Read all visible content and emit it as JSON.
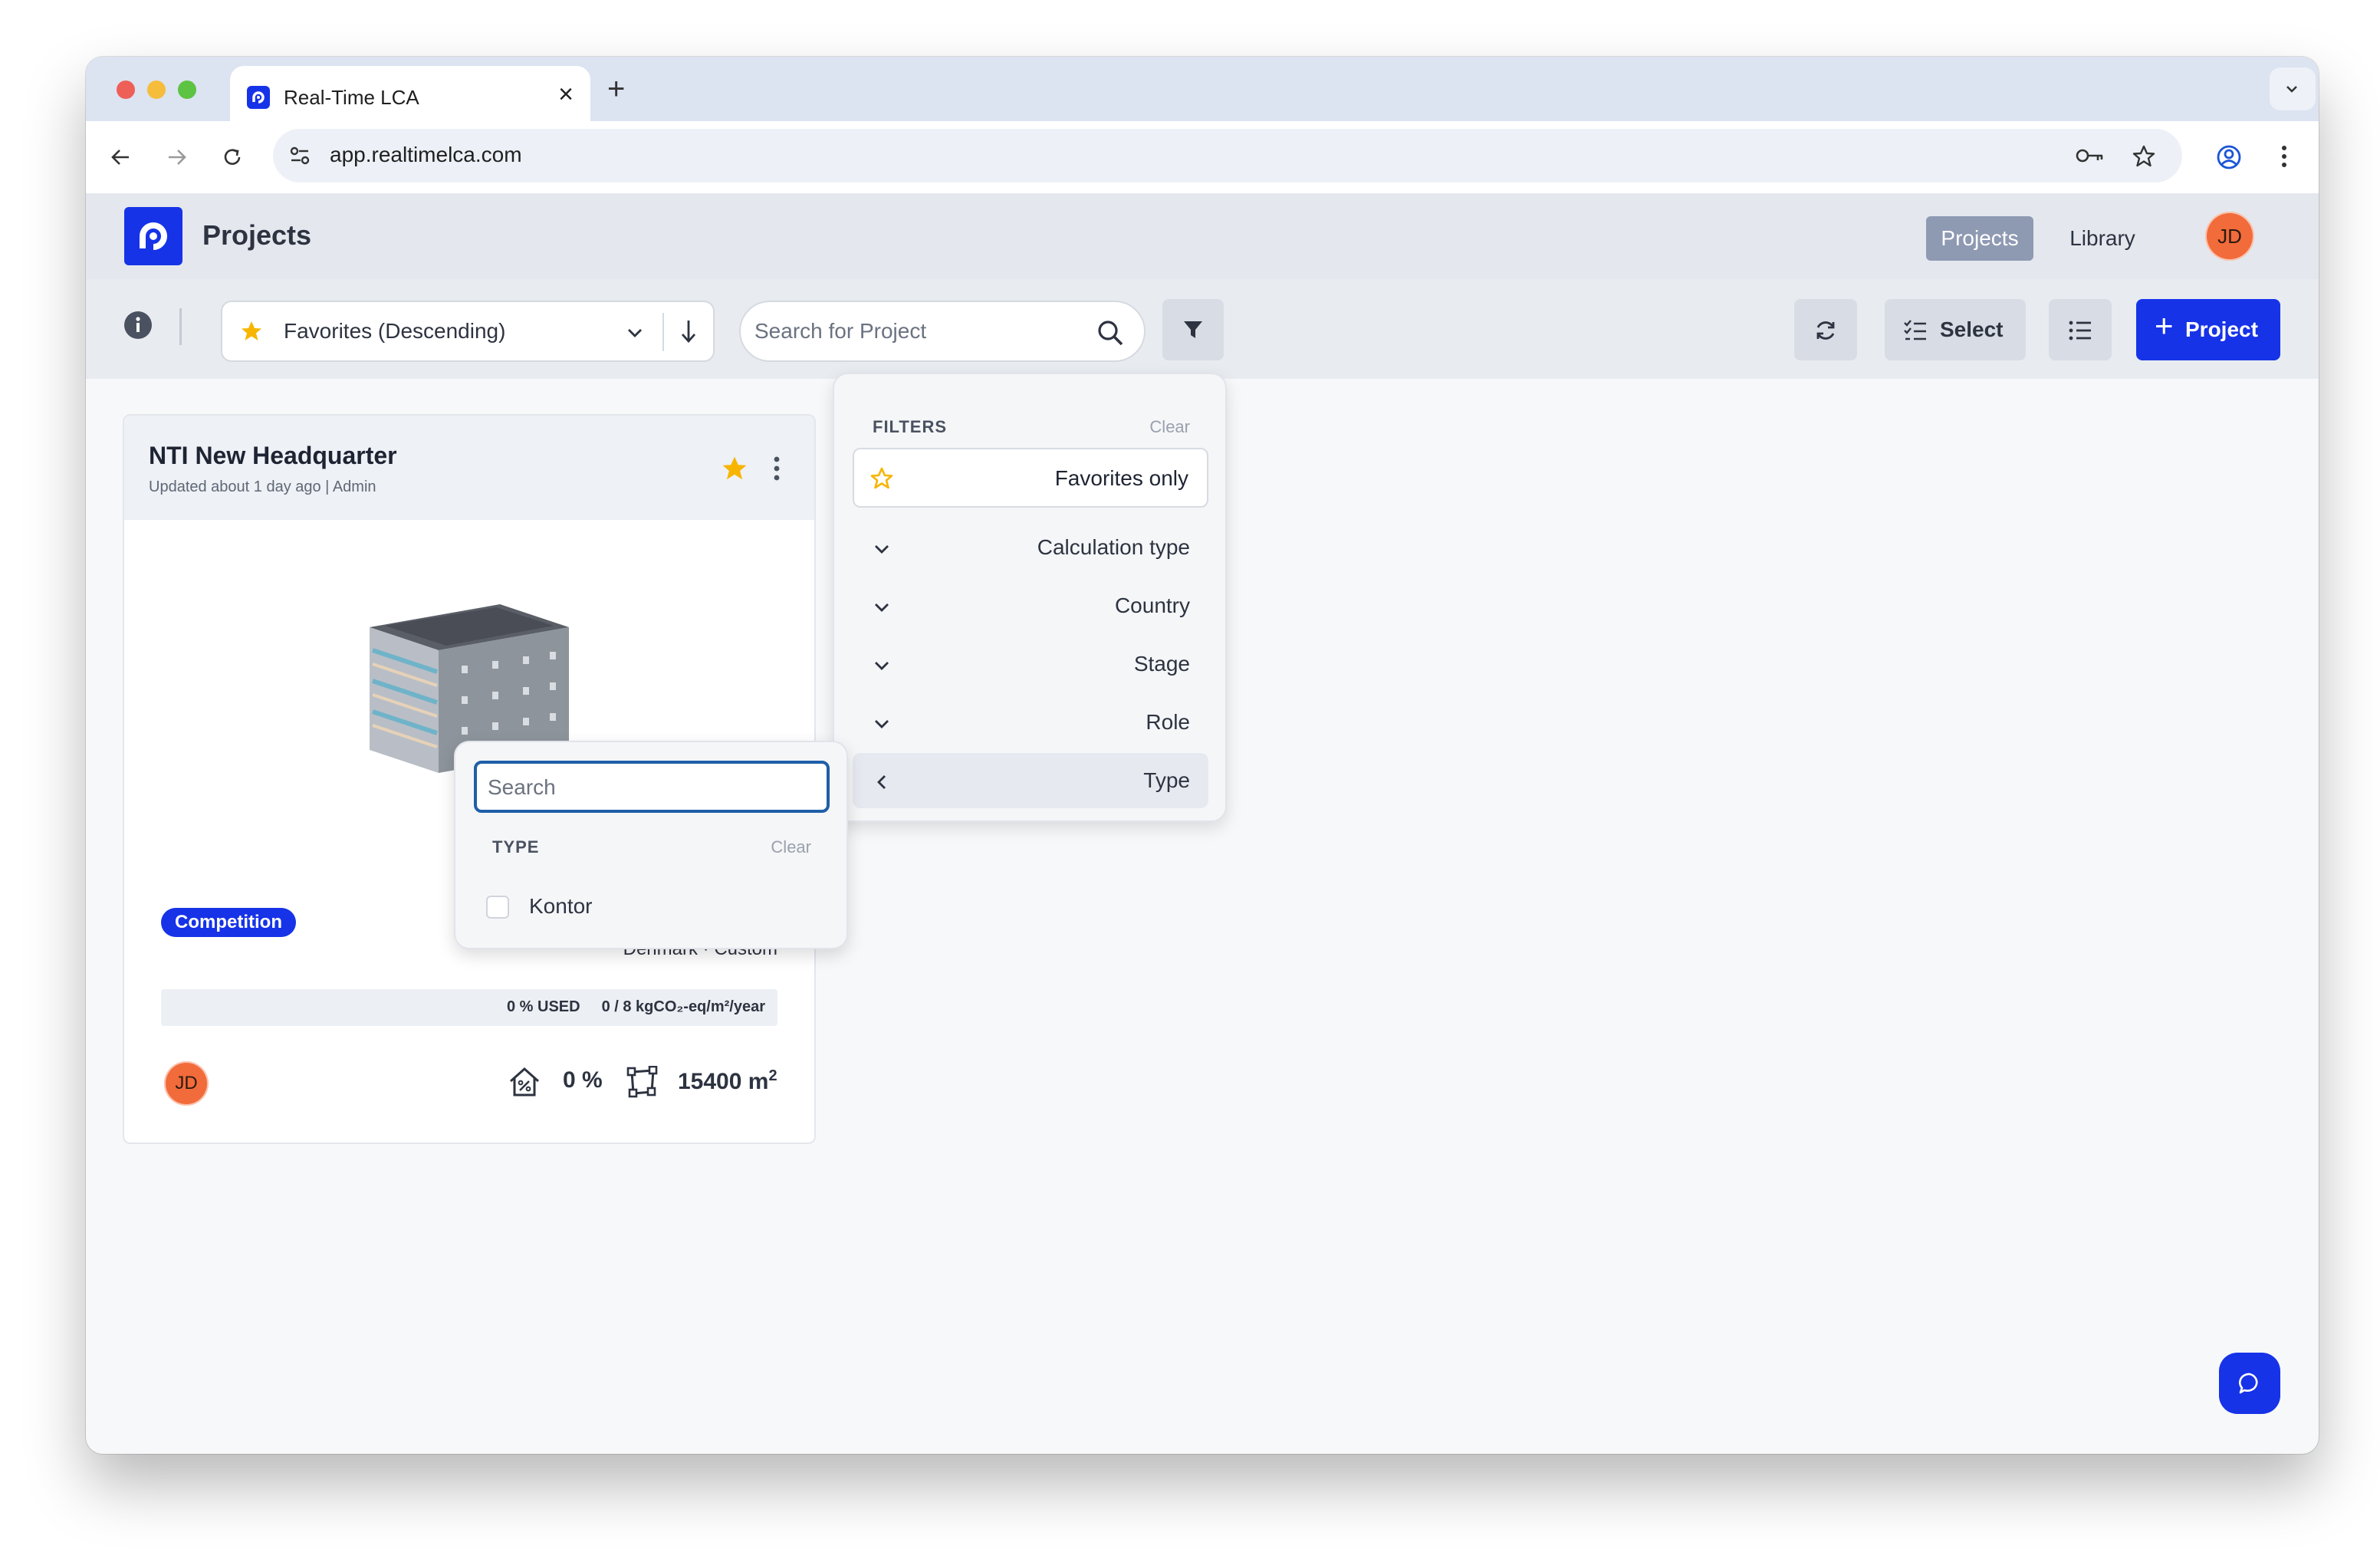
{
  "browser": {
    "tab_title": "Real-Time LCA",
    "url": "app.realtimelca.com"
  },
  "app": {
    "title": "Projects",
    "nav": [
      {
        "label": "Projects",
        "active": true
      },
      {
        "label": "Library",
        "active": false
      }
    ],
    "user_initials": "JD"
  },
  "toolbar": {
    "sort_label": "Favorites (Descending)",
    "search_placeholder": "Search for Project",
    "select_label": "Select",
    "add_project_label": "Project"
  },
  "project_card": {
    "title": "NTI New Headquarter",
    "meta": "Updated about 1 day ago | Admin",
    "favorite": true,
    "tag": "Competition",
    "location": "Denmark · Custom",
    "usage_used": "0 % USED",
    "usage_limit": "0 / 8 kgCO₂-eq/m²/year",
    "usage_fraction": 0,
    "owner_initials": "JD",
    "stat_percent": "0 %",
    "stat_area": "15400 m",
    "stat_area_unit_sup": "2"
  },
  "filters_panel": {
    "title": "FILTERS",
    "clear": "Clear",
    "favorites_only": "Favorites only",
    "groups": [
      "Calculation type",
      "Country",
      "Stage",
      "Role",
      "Type"
    ],
    "active_group": "Type"
  },
  "type_panel": {
    "search_placeholder": "Search",
    "title": "TYPE",
    "clear": "Clear",
    "options": [
      {
        "label": "Kontor",
        "checked": false
      }
    ]
  },
  "colors": {
    "brand": "#1633e8",
    "avatar": "#f26b3a",
    "star": "#f7b500"
  }
}
